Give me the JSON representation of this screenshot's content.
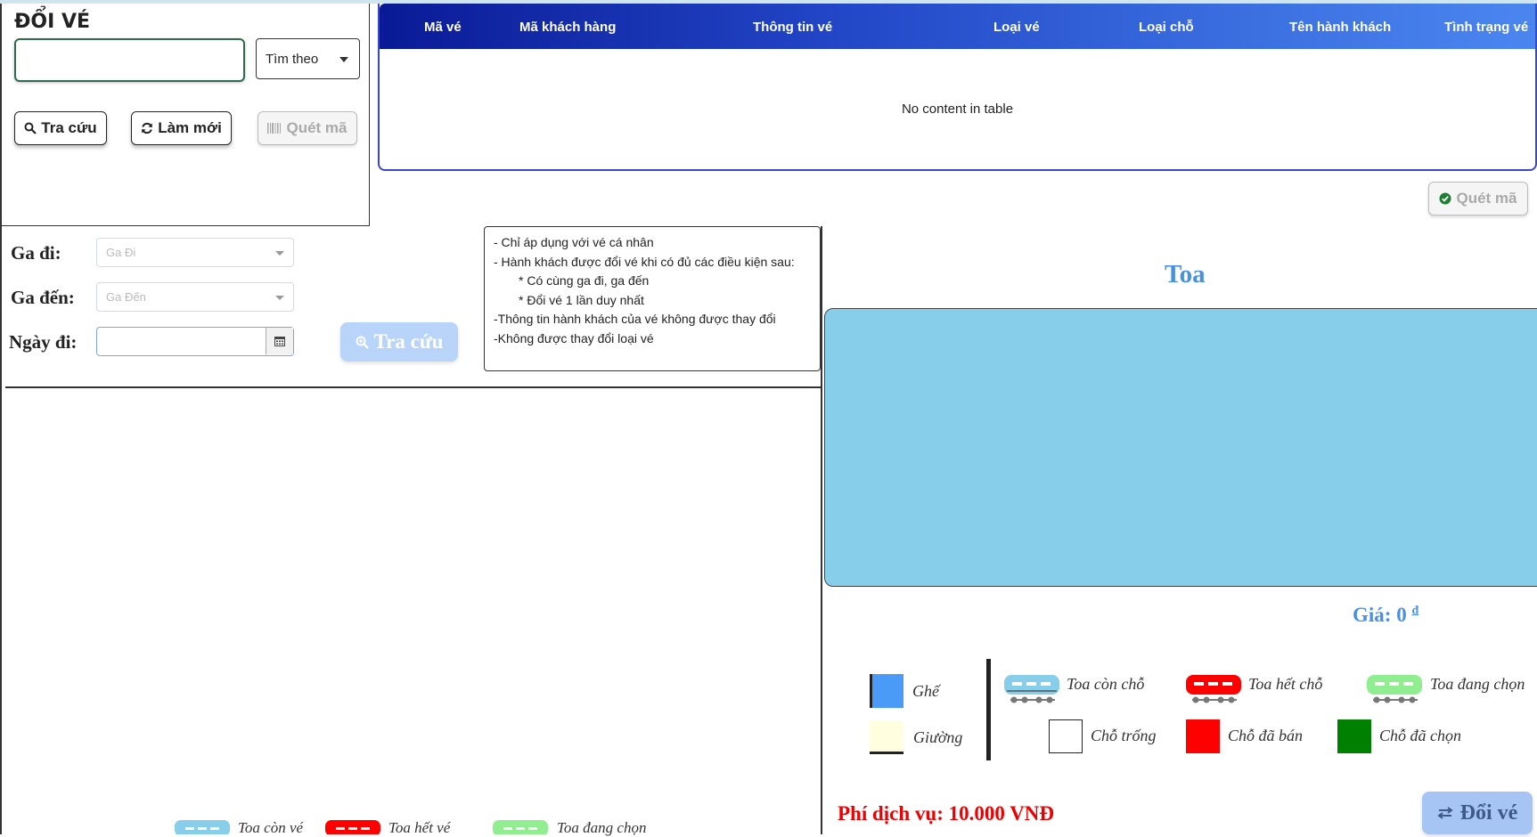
{
  "search_panel": {
    "title": "ĐỔI VÉ",
    "code_value": "",
    "find_by_label": "Tìm theo",
    "lookup_label": "Tra cứu",
    "refresh_label": "Làm mới",
    "scan_label": "Quét mã"
  },
  "ticket_table": {
    "columns": [
      "Mã vé",
      "Mã khách hàng",
      "Thông tin vé",
      "Loại vé",
      "Loại chỗ",
      "Tên hành khách",
      "Tình trạng vé"
    ],
    "empty_text": "No content in table",
    "scan_label": "Quét mã"
  },
  "trip_form": {
    "from_label": "Ga đi:",
    "from_placeholder": "Ga Đi",
    "to_label": "Ga đến:",
    "to_placeholder": "Ga Đến",
    "date_label": "Ngày đi:",
    "date_value": "",
    "lookup_label": "Tra cứu"
  },
  "rules": [
    "- Chỉ áp dụng với vé cá nhân",
    "- Hành khách được đổi vé khi có đủ các điều kiện sau:",
    "* Có cùng ga đi, ga đến",
    "* Đổi vé 1 lần duy nhất",
    "-Thông tin hành khách của vé không được thay đổi",
    "-Không được thay đổi loại vé"
  ],
  "train_legend": {
    "available": "Toa còn vé",
    "sold_out": "Toa hết vé",
    "selecting": "Toa đang chọn"
  },
  "coach": {
    "title": "Toa",
    "price_label": "Giá: 0",
    "currency": "đ"
  },
  "seat_legend": {
    "seat": "Ghế",
    "bed": "Giường",
    "coach_available": "Toa còn chỗ",
    "coach_full": "Toa hết chỗ",
    "coach_selecting": "Toa đang chọn",
    "empty": "Chỗ trống",
    "sold": "Chỗ đã bán",
    "chosen": "Chỗ đã chọn"
  },
  "fee_label": "Phí dịch vụ: 10.000 VNĐ",
  "change_button_label": "Đổi vé",
  "colors": {
    "header_dark": "#0a1a96",
    "header_light": "#4b86ef",
    "accent_blue": "#4a90e2",
    "seat_blue": "#4a9af8",
    "bed_cream": "#ffffe0",
    "sold_red": "#ff0000",
    "chosen_green": "#008000",
    "train_available": "#87ceeb",
    "train_full": "#ff0000",
    "train_selecting": "#90ee90",
    "map_bg": "#87ceeb",
    "fee_red": "#e00000"
  }
}
